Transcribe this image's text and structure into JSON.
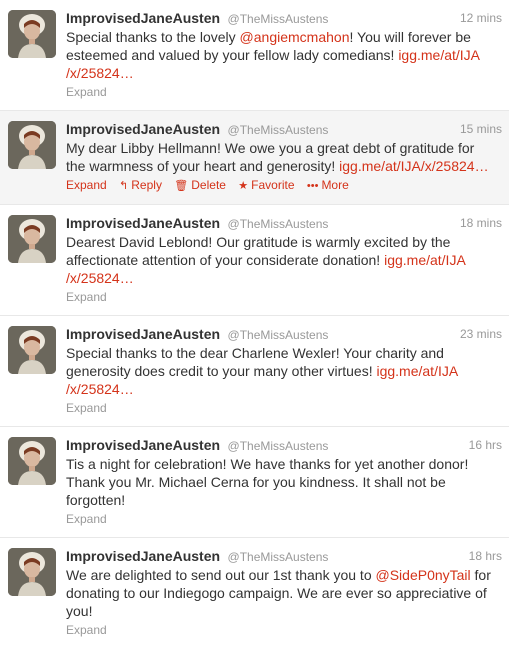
{
  "colors": {
    "link": "#d4331a",
    "meta": "#999999",
    "text": "#333333"
  },
  "actions": {
    "expand": "Expand",
    "reply": "Reply",
    "delete": "Delete",
    "favorite": "Favorite",
    "more": "More",
    "reply_icon": "reply-arrow-icon",
    "delete_icon": "trash-icon",
    "favorite_icon": "star-icon",
    "more_icon": "dots-icon"
  },
  "tweets": [
    {
      "fullname": "ImprovisedJaneAusten",
      "username": "@TheMissAustens",
      "time": "12 mins",
      "text_parts": [
        "Special thanks to the lovely ",
        "@angiemcmahon",
        "! You will forever be esteemed and valued by your fellow lady comedians! ",
        "igg.me/at/IJA /x/25824…"
      ]
    },
    {
      "fullname": "ImprovisedJaneAusten",
      "username": "@TheMissAustens",
      "time": "15 mins",
      "text_parts": [
        "My dear Libby Hellmann! We owe you a great debt of gratitude for the warmness of your heart and generosity! ",
        "igg.me/at/IJA/x/25824…"
      ]
    },
    {
      "fullname": "ImprovisedJaneAusten",
      "username": "@TheMissAustens",
      "time": "18 mins",
      "text_parts": [
        "Dearest David Leblond! Our gratitude is warmly excited by the affectionate attention of your considerate donation! ",
        "igg.me/at/IJA /x/25824…"
      ]
    },
    {
      "fullname": "ImprovisedJaneAusten",
      "username": "@TheMissAustens",
      "time": "23 mins",
      "text_parts": [
        "Special thanks to the dear Charlene Wexler! Your charity and generosity does credit to your many other virtues! ",
        "igg.me/at/IJA /x/25824…"
      ]
    },
    {
      "fullname": "ImprovisedJaneAusten",
      "username": "@TheMissAustens",
      "time": "16 hrs",
      "text_parts": [
        "Tis a night for celebration! We have thanks for yet another donor! Thank you Mr. Michael Cerna for you kindness. It shall not be forgotten!"
      ]
    },
    {
      "fullname": "ImprovisedJaneAusten",
      "username": "@TheMissAustens",
      "time": "18 hrs",
      "text_parts": [
        "We are delighted to send out our 1st thank you to ",
        "@SideP0nyTail",
        " for donating to our Indiegogo campaign. We are ever so appreciative of you!"
      ]
    }
  ]
}
